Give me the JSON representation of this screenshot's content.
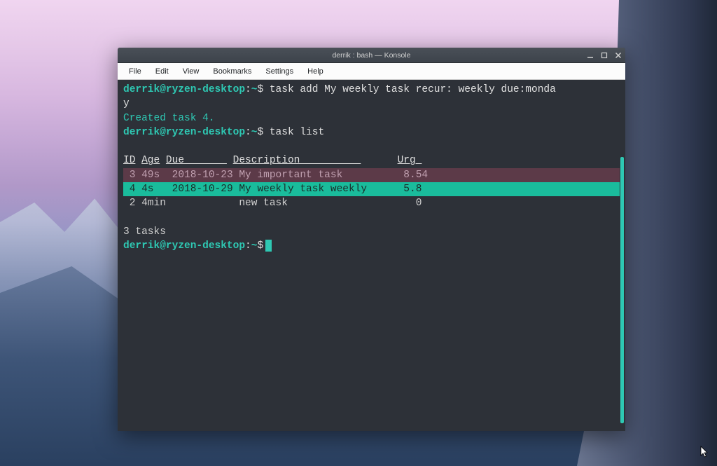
{
  "window": {
    "title": "derrik : bash — Konsole"
  },
  "menubar": {
    "file": "File",
    "edit": "Edit",
    "view": "View",
    "bookmarks": "Bookmarks",
    "settings": "Settings",
    "help": "Help"
  },
  "prompt": {
    "userhost": "derrik@ryzen-desktop",
    "colon": ":",
    "path": "~",
    "dollar": "$"
  },
  "commands": {
    "line1_cmd": " task add My weekly task recur: weekly due:monda",
    "line1_wrap": "y",
    "created_msg": "Created task 4.",
    "line2_cmd": " task list",
    "summary": "3 tasks"
  },
  "table": {
    "headers": {
      "id": "ID",
      "age": "Age",
      "due": "Due       ",
      "description": "Description          ",
      "urg": "Urg "
    },
    "rows": [
      {
        "id": " 3",
        "age": "49s ",
        "due": "2018-10-23",
        "description": "My important task         ",
        "urg": "8.54"
      },
      {
        "id": " 4",
        "age": "4s  ",
        "due": "2018-10-29",
        "description": "My weekly task weekly    ",
        "urg": " 5.8"
      },
      {
        "id": " 2",
        "age": "4min",
        "due": "          ",
        "description": "new task                    ",
        "urg": "0"
      }
    ]
  }
}
